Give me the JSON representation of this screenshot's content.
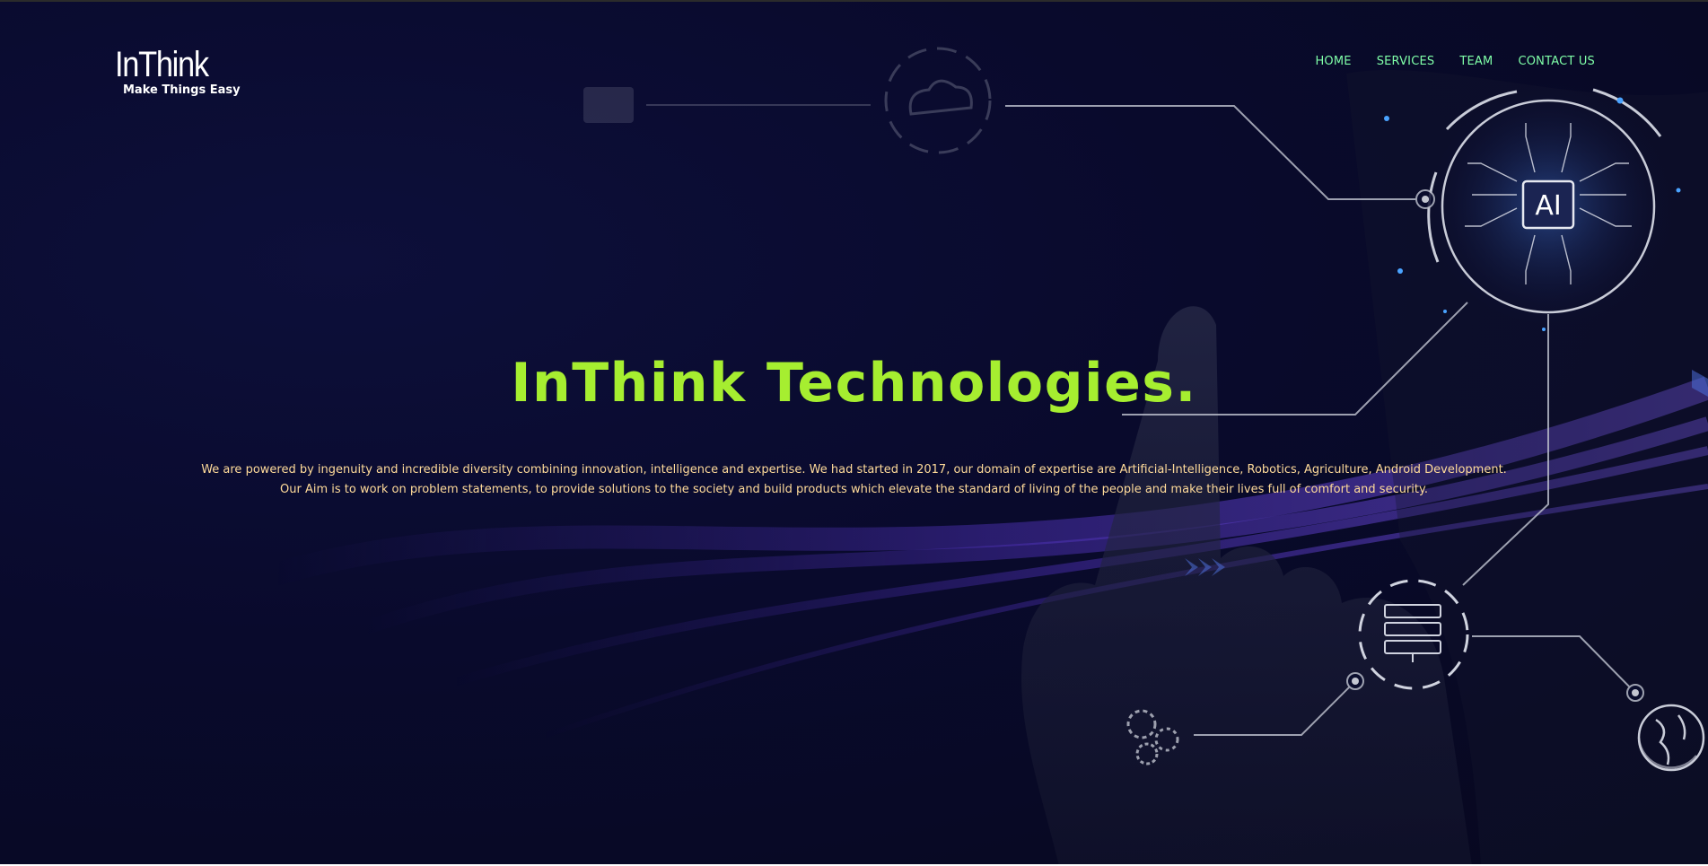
{
  "brand": {
    "name": "InThink",
    "tagline": "Make Things Easy"
  },
  "nav": {
    "items": [
      "HOME",
      "SERVICES",
      "TEAM",
      "CONTACT US"
    ]
  },
  "hero": {
    "title": "InThink Technologies.",
    "lines": [
      "We are powered by ingenuity and incredible diversity combining innovation, intelligence and expertise. We had started in 2017, our domain of expertise are Artificial-Intelligence, Robotics, Agriculture, Android Development.",
      "Our Aim is to work on problem statements, to provide solutions to the society and build products which elevate the standard of living of the people and make their lives full of comfort and security."
    ],
    "chip_label": "AI"
  },
  "colors": {
    "background": "#090a2c",
    "headline": "#a6ee30",
    "nav": "#7fffa8",
    "body_text": "#ffdb9a"
  }
}
